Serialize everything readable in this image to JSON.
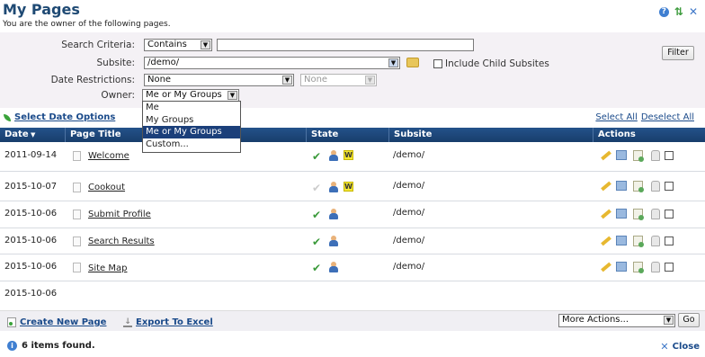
{
  "header": {
    "title": "My Pages",
    "subtitle": "You are the owner of the following pages.",
    "icons": [
      "help-icon",
      "refresh-icon",
      "close-icon"
    ]
  },
  "criteria": {
    "search_label": "Search Criteria:",
    "search_mode": "Contains",
    "search_value": "",
    "subsite_label": "Subsite:",
    "subsite_value": "/demo/",
    "include_child_label": "Include Child Subsites",
    "include_child_checked": false,
    "date_label": "Date Restrictions:",
    "date_value": "None",
    "date_value2": "None",
    "owner_label": "Owner:",
    "owner_value": "Me or My Groups",
    "owner_options": [
      "Me",
      "My Groups",
      "Me or My Groups",
      "Custom..."
    ],
    "filter_label": "Filter"
  },
  "links": {
    "select_date_options": "Select Date Options",
    "select_all": "Select All",
    "deselect_all": "Deselect All"
  },
  "table": {
    "columns": [
      "Date",
      "Page Title",
      "State",
      "Subsite",
      "Actions"
    ],
    "rows": [
      {
        "date": "2011-09-14",
        "title": "Welcome",
        "subsite": "/demo/",
        "published": true,
        "workflow": true
      },
      {
        "date": "2015-10-07",
        "title": "Cookout",
        "subsite": "/demo/",
        "published": false,
        "workflow": true
      },
      {
        "date": "2015-10-06",
        "title": "Submit Profile",
        "subsite": "/demo/",
        "published": true,
        "workflow": false
      },
      {
        "date": "2015-10-06",
        "title": "Search Results",
        "subsite": "/demo/",
        "published": true,
        "workflow": false
      },
      {
        "date": "2015-10-06",
        "title": "Site Map",
        "subsite": "/demo/",
        "published": true,
        "workflow": false
      },
      {
        "date": "2015-10-06",
        "title": "",
        "subsite": "",
        "published": null,
        "workflow": false
      }
    ]
  },
  "footer": {
    "create_label": "Create New Page",
    "export_label": "Export To Excel",
    "more_actions": "More Actions...",
    "go_label": "Go",
    "status": "6 items found.",
    "close_label": "Close"
  }
}
